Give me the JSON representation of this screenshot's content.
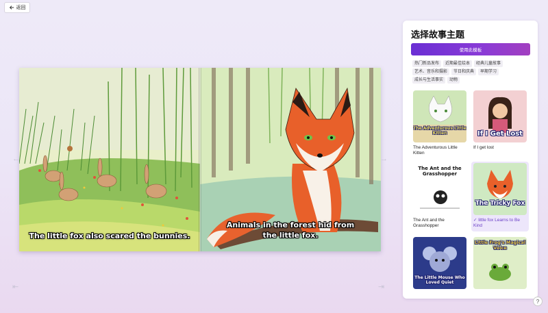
{
  "header": {
    "back_label": "返回"
  },
  "book": {
    "left_caption": "The little fox also scared the bunnies.",
    "right_caption_line1": "Animals in the forest hid from",
    "right_caption_line2": "the little fox."
  },
  "panel": {
    "title": "选择故事主题",
    "use_button": "使用此模板",
    "tags": [
      "热门新品发布",
      "近期最佳绘本",
      "经典儿童故事",
      "艺术、音乐和摄影",
      "节日和庆典",
      "早期学习",
      "成长与生活事实",
      "动物"
    ],
    "cards": [
      {
        "label": "The Adventurous Little Kitten",
        "thumb_title": "The Adventurous Little Kitten",
        "selected": false
      },
      {
        "label": "If I get lost",
        "thumb_title": "If I Get Lost",
        "selected": false
      },
      {
        "label": "The Ant and the Grasshopper",
        "thumb_title": "The Ant and the Grasshopper",
        "selected": false
      },
      {
        "label": "little fox Learns to Be Kind",
        "thumb_title": "The Tricky Fox",
        "selected": true
      },
      {
        "label": "",
        "thumb_title": "The Little Mouse Who Loved Quiet",
        "selected": false
      },
      {
        "label": "",
        "thumb_title": "Little Frog's Magical Voice",
        "selected": false
      }
    ],
    "check_icon": "✓"
  },
  "help_label": "?",
  "colors": {
    "accent": "#7b35d4",
    "selected_bg": "#ede6fb"
  }
}
